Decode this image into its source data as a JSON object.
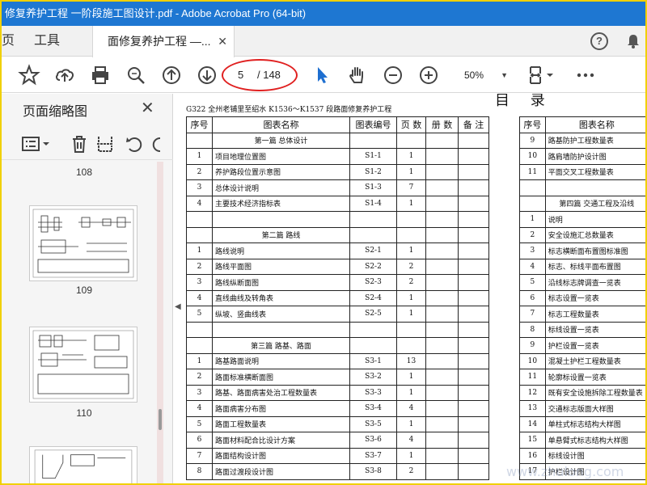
{
  "window": {
    "title": "修复养护工程 一阶段施工图设计.pdf - Adobe Acrobat Pro (64-bit)"
  },
  "tabs": {
    "home": "页",
    "tools": "工具",
    "document": "面修复养护工程 —..."
  },
  "toolbar": {
    "current_page": "5",
    "total_pages": "/ 148",
    "zoom": "50%"
  },
  "panel": {
    "title": "页面缩略图",
    "thumb_labels": [
      "108",
      "109",
      "110"
    ]
  },
  "doc": {
    "heading": "目 录",
    "subtitle": "G322 全州老铺里至绍水 K1536～K1537 段路面修复养护工程",
    "headers_left": [
      "序号",
      "图表名称",
      "图表编号",
      "页 数",
      "册 数",
      "备 注"
    ],
    "headers_right": [
      "序号",
      "图表名称"
    ],
    "left_rows": [
      {
        "type": "section",
        "name": "第一篇 总体设计"
      },
      {
        "no": "1",
        "name": "项目地理位置图",
        "code": "S1-1",
        "pages": "1"
      },
      {
        "no": "2",
        "name": "养护路段位置示意图",
        "code": "S1-2",
        "pages": "1"
      },
      {
        "no": "3",
        "name": "总体设计说明",
        "code": "S1-3",
        "pages": "7"
      },
      {
        "no": "4",
        "name": "主要技术经济指标表",
        "code": "S1-4",
        "pages": "1"
      },
      {
        "type": "blank"
      },
      {
        "type": "section",
        "name": "第二篇 路线"
      },
      {
        "no": "1",
        "name": "路线说明",
        "code": "S2-1",
        "pages": "1"
      },
      {
        "no": "2",
        "name": "路线平面图",
        "code": "S2-2",
        "pages": "2"
      },
      {
        "no": "3",
        "name": "路线纵断面图",
        "code": "S2-3",
        "pages": "2"
      },
      {
        "no": "4",
        "name": "直线曲线及转角表",
        "code": "S2-4",
        "pages": "1"
      },
      {
        "no": "5",
        "name": "纵坡、竖曲线表",
        "code": "S2-5",
        "pages": "1"
      },
      {
        "type": "blank"
      },
      {
        "type": "section",
        "name": "第三篇 路基、路面"
      },
      {
        "no": "1",
        "name": "路基路面说明",
        "code": "S3-1",
        "pages": "13"
      },
      {
        "no": "2",
        "name": "路面标准横断面图",
        "code": "S3-2",
        "pages": "1"
      },
      {
        "no": "3",
        "name": "路基、路面病害处治工程数量表",
        "code": "S3-3",
        "pages": "1"
      },
      {
        "no": "4",
        "name": "路面病害分布图",
        "code": "S3-4",
        "pages": "4"
      },
      {
        "no": "5",
        "name": "路面工程数量表",
        "code": "S3-5",
        "pages": "1"
      },
      {
        "no": "6",
        "name": "路面材料配合比设计方案",
        "code": "S3-6",
        "pages": "4"
      },
      {
        "no": "7",
        "name": "路面结构设计图",
        "code": "S3-7",
        "pages": "1"
      },
      {
        "no": "8",
        "name": "路面过渡段设计图",
        "code": "S3-8",
        "pages": "2"
      }
    ],
    "right_rows": [
      {
        "no": "9",
        "name": "路基防护工程数量表"
      },
      {
        "no": "10",
        "name": "路肩墙防护设计图"
      },
      {
        "no": "11",
        "name": "平面交叉工程数量表"
      },
      {
        "type": "blank"
      },
      {
        "type": "section",
        "name": "第四篇 交通工程及沿线"
      },
      {
        "no": "1",
        "name": "说明"
      },
      {
        "no": "2",
        "name": "安全设施汇总数量表"
      },
      {
        "no": "3",
        "name": "标志横断面布置图标准图"
      },
      {
        "no": "4",
        "name": "标志、标线平面布置图"
      },
      {
        "no": "5",
        "name": "沿线标志牌调查一览表"
      },
      {
        "no": "6",
        "name": "标志设置一览表"
      },
      {
        "no": "7",
        "name": "标志工程数量表"
      },
      {
        "no": "8",
        "name": "标线设置一览表"
      },
      {
        "no": "9",
        "name": "护栏设置一览表"
      },
      {
        "no": "10",
        "name": "混凝土护栏工程数量表"
      },
      {
        "no": "11",
        "name": "轮廓标设置一览表"
      },
      {
        "no": "12",
        "name": "既有安全设施拆除工程数量表"
      },
      {
        "no": "13",
        "name": "交通标志版面大样图"
      },
      {
        "no": "14",
        "name": "单柱式标志结构大样图"
      },
      {
        "no": "15",
        "name": "单悬臂式标志结构大样图"
      },
      {
        "no": "16",
        "name": "标线设计图"
      },
      {
        "no": "17",
        "name": "护栏设计图"
      }
    ],
    "watermark": "www.zhulong.com"
  },
  "colors": {
    "titlebar": "#1e77d2",
    "accent_red": "#e02020",
    "frame": "#ffe000"
  }
}
